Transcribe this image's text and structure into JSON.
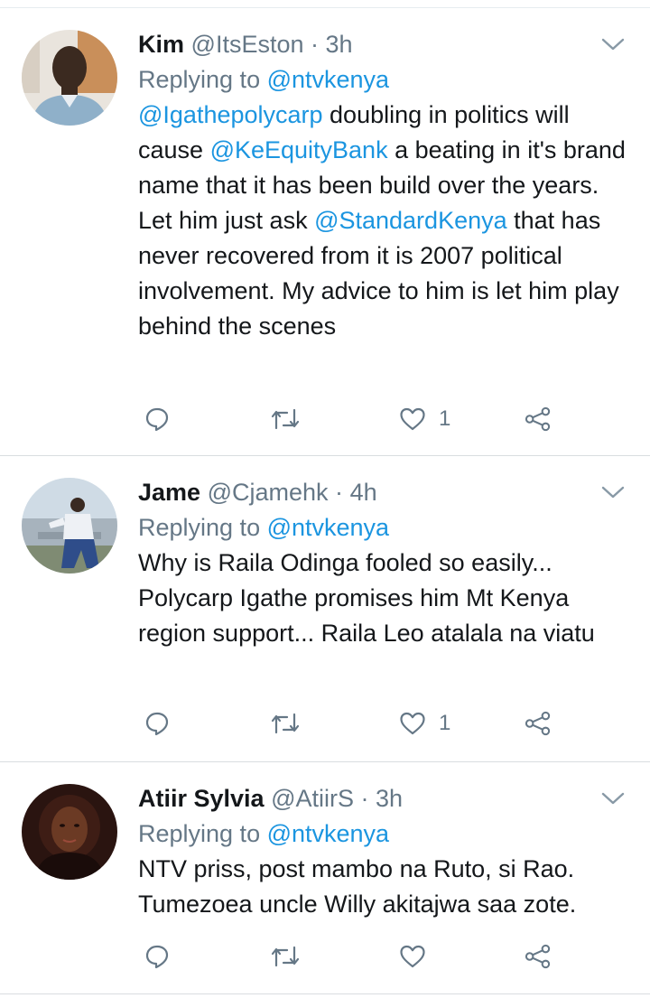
{
  "tweets": [
    {
      "name": "Kim",
      "handle": "@ItsEston",
      "dot": "·",
      "time": "3h",
      "replying_prefix": "Replying to ",
      "replying_to": "@ntvkenya",
      "text_segments": [
        {
          "m": "@Igathepolycarp"
        },
        {
          "t": " doubling in politics will cause "
        },
        {
          "m": "@KeEquityBank"
        },
        {
          "t": " a beating in it's brand name that it has been build over the years. Let him just ask "
        },
        {
          "m": "@StandardKenya"
        },
        {
          "t": " that has never recovered from it is 2007 political involvement.  My advice to him is let him play behind the scenes"
        }
      ],
      "like_count": "1"
    },
    {
      "name": "Jame",
      "handle": "@Cjamehk",
      "dot": "·",
      "time": "4h",
      "replying_prefix": "Replying to ",
      "replying_to": "@ntvkenya",
      "text_segments": [
        {
          "t": "Why is Raila Odinga fooled so easily... Polycarp Igathe promises him Mt Kenya region support... Raila Leo atalala na viatu"
        }
      ],
      "like_count": "1"
    },
    {
      "name": "Atiir Sylvia",
      "handle": "@AtiirS",
      "dot": "·",
      "time": "3h",
      "replying_prefix": "Replying to ",
      "replying_to": "@ntvkenya",
      "text_segments": [
        {
          "t": "NTV priss, post mambo na Ruto, si Rao. Tumezoea uncle Willy akitajwa saa zote."
        }
      ],
      "like_count": ""
    }
  ],
  "colors": {
    "link": "#1b95e0",
    "secondary": "#657786",
    "primary": "#14171a",
    "divider": "#d9dde0"
  },
  "icons": {
    "reply": "reply-icon",
    "retweet": "retweet-icon",
    "like": "heart-icon",
    "share": "share-icon",
    "menu": "chevron-down-icon"
  }
}
